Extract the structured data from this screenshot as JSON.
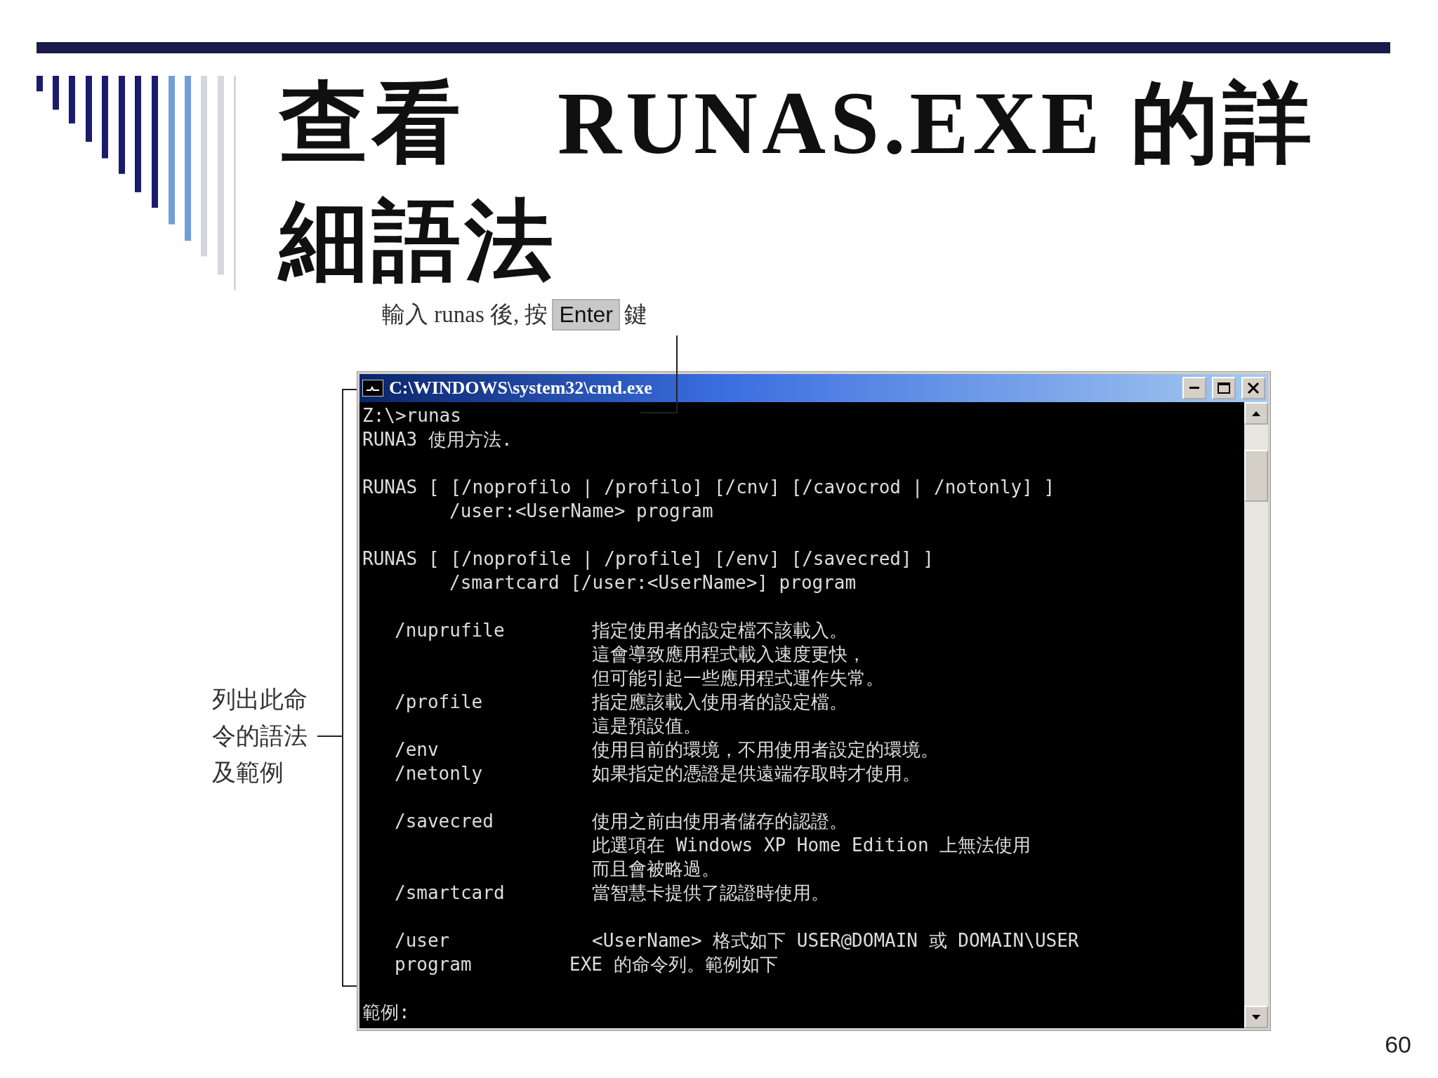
{
  "title": "查看　RUNAS.EXE 的詳細語法",
  "top_note": {
    "before": "輸入 runas 後, 按",
    "key": "Enter",
    "after": "鍵"
  },
  "side_note": "列出此命令的語法及範例",
  "window": {
    "title": "C:\\WINDOWS\\system32\\cmd.exe",
    "lines": [
      {
        "kind": "text",
        "text": "Z:\\>runas"
      },
      {
        "kind": "text",
        "text": "RUNA3 使用方法."
      },
      {
        "kind": "blank"
      },
      {
        "kind": "text",
        "text": "RUNAS [ [/noprofilo | /profilo] [/cnv] [/cavocrod | /notonly] ]"
      },
      {
        "kind": "continuation",
        "text": "/user:<UserName> program"
      },
      {
        "kind": "blank"
      },
      {
        "kind": "text",
        "text": "RUNAS [ [/noprofile | /profile] [/env] [/savecred] ]"
      },
      {
        "kind": "continuation",
        "text": "/smartcard [/user:<UserName>] program"
      },
      {
        "kind": "blank"
      },
      {
        "kind": "option",
        "option": "/nuprufile",
        "description": "指定使用者的設定檔不該載入。"
      },
      {
        "kind": "detail",
        "description": "這會導致應用程式載入速度更快，"
      },
      {
        "kind": "detail",
        "description": "但可能引起一些應用程式運作失常。"
      },
      {
        "kind": "option",
        "option": "/profile",
        "description": "指定應該載入使用者的設定檔。"
      },
      {
        "kind": "detail",
        "description": "這是預設值。"
      },
      {
        "kind": "option",
        "option": "/env",
        "description": "使用目前的環境，不用使用者設定的環境。"
      },
      {
        "kind": "option",
        "option": "/netonly",
        "description": "如果指定的憑證是供遠端存取時才使用。"
      },
      {
        "kind": "blank"
      },
      {
        "kind": "option",
        "option": "/savecred",
        "description": "使用之前由使用者儲存的認證。"
      },
      {
        "kind": "detail",
        "description": "此選項在 Windows XP Home Edition 上無法使用"
      },
      {
        "kind": "detail",
        "description": "而且會被略過。"
      },
      {
        "kind": "option",
        "option": "/smartcard",
        "description": "當智慧卡提供了認證時使用。"
      },
      {
        "kind": "blank"
      },
      {
        "kind": "option",
        "option": "/user",
        "description": "<UserName> 格式如下 USER@DOMAIN 或 DOMAIN\\USER"
      },
      {
        "kind": "option_outdent",
        "option": "program",
        "description": "EXE 的命令列。範例如下"
      },
      {
        "kind": "blank"
      },
      {
        "kind": "text",
        "text": "範例:"
      }
    ]
  },
  "page_number": "60"
}
